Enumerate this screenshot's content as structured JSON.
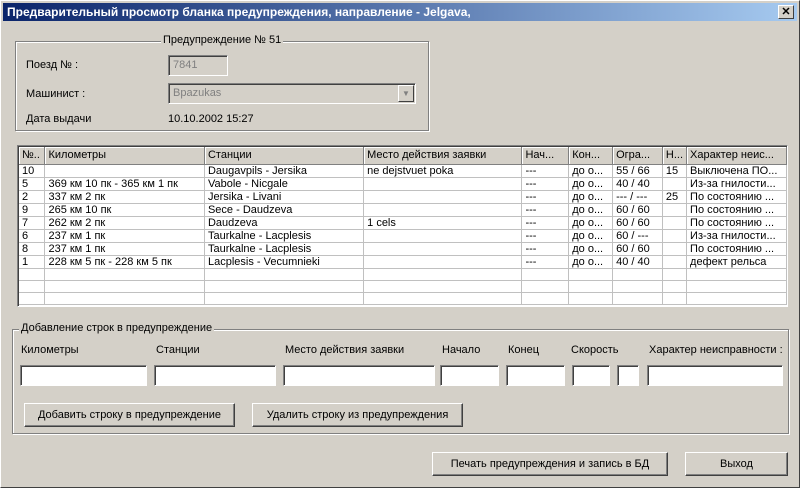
{
  "window": {
    "title": "Предварительный просмотр бланка предупреждения,  направление  -  Jelgava,",
    "close_label": "✕"
  },
  "warning_group": {
    "title": "Предупреждение № 51",
    "train_label": "Поезд № :",
    "train_value": "7841",
    "driver_label": "Машинист :",
    "driver_value": "Bpazukas",
    "date_label": "Дата выдачи",
    "date_value": "10.10.2002   15:27"
  },
  "table": {
    "headers": [
      "№..",
      "Километры",
      "Станции",
      "Место действия заявки",
      "Нач...",
      "Кон...",
      "Огра...",
      "Н...",
      "Характер неис..."
    ],
    "rows": [
      [
        "10",
        "",
        "Daugavpils - Jersika",
        "ne dejstvuet poka",
        "---",
        "до о...",
        "55 / 66",
        "15",
        "Выключена ПО..."
      ],
      [
        "5",
        "369 км 10 пк  - 365 км 1 пк",
        "Vabole - Nicgale",
        "",
        "---",
        "до о...",
        "40 / 40",
        "",
        "Из-за гнилости..."
      ],
      [
        "2",
        "337 км 2 пк",
        "Jersika - Livani",
        "",
        "---",
        "до о...",
        "--- / ---",
        "25",
        "По состоянию ..."
      ],
      [
        "9",
        "265 км 10 пк",
        "Sece - Daudzeva",
        "",
        "---",
        "до о...",
        "60 / 60",
        "",
        "По состоянию ..."
      ],
      [
        "7",
        "262 км 2 пк",
        "Daudzeva",
        "1 cels",
        "---",
        "до о...",
        "60 / 60",
        "",
        "По состоянию ..."
      ],
      [
        "6",
        "237 км 1 пк",
        "Taurkalne - Lacplesis",
        "",
        "---",
        "до о...",
        "60 / ---",
        "",
        "Из-за гнилости..."
      ],
      [
        "8",
        "237 км 1 пк",
        "Taurkalne - Lacplesis",
        "",
        "---",
        "до о...",
        "60 / 60",
        "",
        "По состоянию ..."
      ],
      [
        "1",
        "228 км 5 пк  - 228 км 5 пк",
        "Lacplesis - Vecumnieki",
        "",
        "---",
        "до о...",
        "40 / 40",
        "",
        "дефект рельса"
      ],
      [
        "",
        "",
        "",
        "",
        "",
        "",
        "",
        "",
        ""
      ],
      [
        "",
        "",
        "",
        "",
        "",
        "",
        "",
        "",
        ""
      ],
      [
        "",
        "",
        "",
        "",
        "",
        "",
        "",
        "",
        ""
      ]
    ]
  },
  "add_group": {
    "title": "Добавление строк в предупреждение",
    "km_label": "Километры",
    "stations_label": "Станции",
    "place_label": "Место действия заявки",
    "start_label": "Начало",
    "end_label": "Конец",
    "speed_label": "Скорость",
    "defect_label": "Характер неисправности :",
    "km_value": "",
    "stations_value": "",
    "place_value": "",
    "start_value": "",
    "end_value": "",
    "speed_value": "",
    "speed2_value": "",
    "defect_value": "",
    "add_button": "Добавить строку в предупреждение",
    "delete_button": "Удалить строку из предупреждения"
  },
  "footer": {
    "print_button": "Печать предупреждения и запись в БД",
    "exit_button": "Выход"
  }
}
